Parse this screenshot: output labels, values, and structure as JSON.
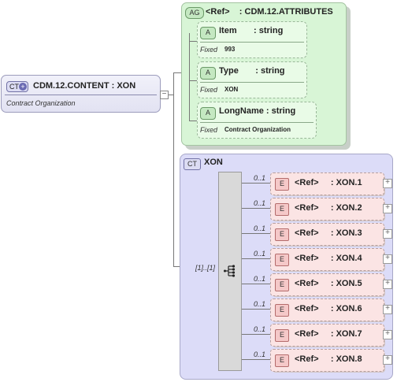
{
  "root": {
    "badge": "CT",
    "name": "CDM.12.CONTENT : XON",
    "documentation": "Contract Organization",
    "connector": "−"
  },
  "attribute_group": {
    "badge": "AG",
    "title": "<Ref>    : CDM.12.ATTRIBUTES",
    "attributes": [
      {
        "badge": "A",
        "name": "Item       : string",
        "fixed_label": "Fixed",
        "fixed_value": "993"
      },
      {
        "badge": "A",
        "name": "Type       : string",
        "fixed_label": "Fixed",
        "fixed_value": "XON"
      },
      {
        "badge": "A",
        "name": "LongName : string",
        "fixed_label": "Fixed",
        "fixed_value": "Contract Organization"
      }
    ]
  },
  "complex_type": {
    "badge": "CT",
    "name": "XON",
    "sequence_multiplicity": "[1]..[1]",
    "elements": [
      {
        "badge": "E",
        "name": "<Ref>     : XON.1",
        "multiplicity": "0..1",
        "expand": "+"
      },
      {
        "badge": "E",
        "name": "<Ref>     : XON.2",
        "multiplicity": "0..1",
        "expand": "+"
      },
      {
        "badge": "E",
        "name": "<Ref>     : XON.3",
        "multiplicity": "0..1",
        "expand": "+"
      },
      {
        "badge": "E",
        "name": "<Ref>     : XON.4",
        "multiplicity": "0..1",
        "expand": "+"
      },
      {
        "badge": "E",
        "name": "<Ref>     : XON.5",
        "multiplicity": "0..1",
        "expand": "+"
      },
      {
        "badge": "E",
        "name": "<Ref>     : XON.6",
        "multiplicity": "0..1",
        "expand": "+"
      },
      {
        "badge": "E",
        "name": "<Ref>     : XON.7",
        "multiplicity": "0..1",
        "expand": "+"
      },
      {
        "badge": "E",
        "name": "<Ref>     : XON.8",
        "multiplicity": "0..1",
        "expand": "+"
      }
    ]
  },
  "colors": {
    "attribute_group_fill": "#d8f5d6",
    "complex_type_fill": "#dcdcf8",
    "element_fill": "#fbe4e4"
  }
}
